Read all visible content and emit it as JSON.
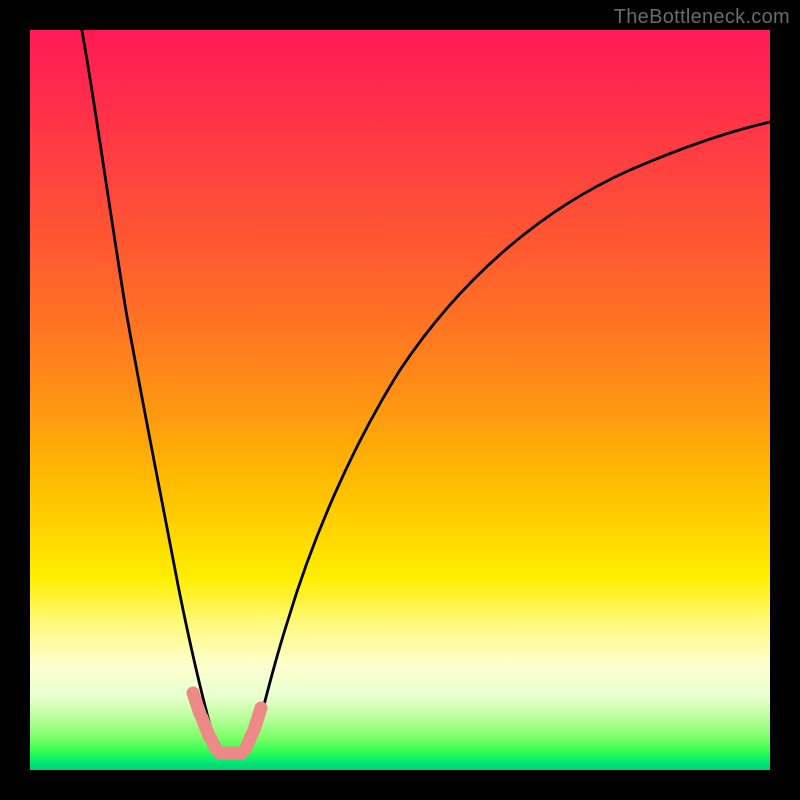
{
  "watermark": "TheBottleneck.com",
  "chart_data": {
    "type": "line",
    "title": "",
    "xlabel": "",
    "ylabel": "",
    "xlim": [
      0,
      100
    ],
    "ylim": [
      0,
      100
    ],
    "grid": false,
    "legend": false,
    "background_gradient": {
      "orientation": "vertical",
      "stops": [
        {
          "pos": 0,
          "color": "#ff1a55"
        },
        {
          "pos": 50,
          "color": "#ff9a10"
        },
        {
          "pos": 75,
          "color": "#ffee00"
        },
        {
          "pos": 100,
          "color": "#00d46a"
        }
      ],
      "note": "Gradient encodes a goodness scale — red (top, bad) to green (bottom, good). The black curve height against the gradient shows bottleneck severity vs x; minimum is near x≈26."
    },
    "series": [
      {
        "name": "bottleneck-curve",
        "color": "#000000",
        "x": [
          7,
          10,
          13,
          16,
          19,
          21,
          23,
          25,
          26,
          27,
          28,
          29,
          31,
          33,
          36,
          40,
          45,
          50,
          56,
          62,
          70,
          80,
          90,
          100
        ],
        "y": [
          100,
          80,
          62,
          46,
          32,
          22,
          14,
          6,
          2,
          2,
          4,
          6,
          10,
          15,
          22,
          31,
          40,
          48,
          55,
          61,
          67,
          73,
          77,
          80
        ]
      },
      {
        "name": "highlight-band",
        "color": "#ed8a87",
        "note": "Small pink segment marking the trough / optimal zone",
        "x": [
          22,
          24,
          25,
          26,
          27,
          28,
          29,
          31
        ],
        "y": [
          9,
          5,
          3,
          2,
          2,
          3,
          5,
          9
        ]
      }
    ]
  }
}
